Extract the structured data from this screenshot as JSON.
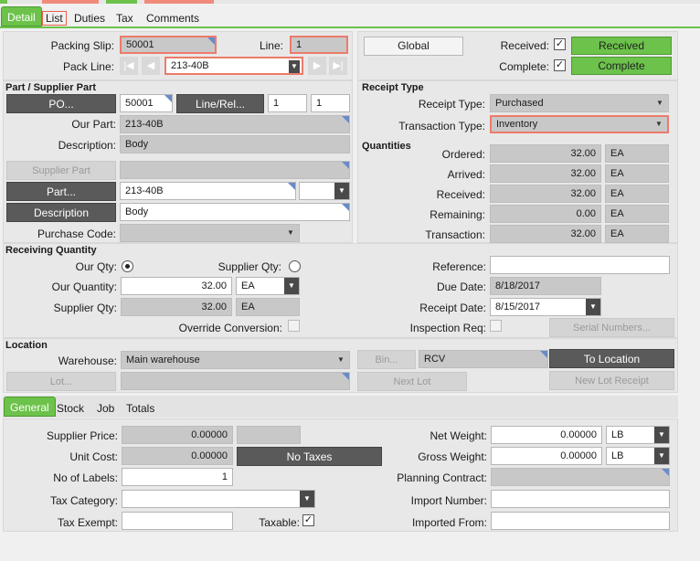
{
  "tabs": {
    "detail": "Detail",
    "list": "List",
    "duties": "Duties",
    "tax": "Tax",
    "comments": "Comments"
  },
  "header": {
    "packing_slip_label": "Packing Slip:",
    "packing_slip_value": "50001",
    "line_label": "Line:",
    "line_value": "1",
    "pack_line_label": "Pack Line:",
    "pack_line_value": "213-40B",
    "global_label": "Global",
    "received_label": "Received:",
    "received_button": "Received",
    "complete_label": "Complete:",
    "complete_button": "Complete",
    "check_glyph": "✓"
  },
  "part_supplier": {
    "title": "Part / Supplier Part",
    "po_button": "PO...",
    "po_value": "50001",
    "line_rel_button": "Line/Rel...",
    "line_value": "1",
    "rel_value": "1",
    "our_part_label": "Our Part:",
    "our_part_value": "213-40B",
    "description_label": "Description:",
    "description_value": "Body",
    "supplier_part_button": "Supplier Part",
    "supplier_part_value": "",
    "part_button": "Part...",
    "part_value": "213-40B",
    "description_button": "Description",
    "description_input": "Body",
    "purchase_code_label": "Purchase Code:",
    "purchase_code_value": ""
  },
  "receipt_type": {
    "title": "Receipt Type",
    "receipt_type_label": "Receipt Type:",
    "receipt_type_value": "Purchased",
    "transaction_type_label": "Transaction Type:",
    "transaction_type_value": "Inventory"
  },
  "quantities": {
    "title": "Quantities",
    "rows": [
      {
        "label": "Ordered:",
        "value": "32.00",
        "uom": "EA"
      },
      {
        "label": "Arrived:",
        "value": "32.00",
        "uom": "EA"
      },
      {
        "label": "Received:",
        "value": "32.00",
        "uom": "EA"
      },
      {
        "label": "Remaining:",
        "value": "0.00",
        "uom": "EA"
      },
      {
        "label": "Transaction:",
        "value": "32.00",
        "uom": "EA"
      }
    ]
  },
  "receiving_qty": {
    "title": "Receiving Quantity",
    "our_qty_label": "Our Qty:",
    "supplier_qty_radio_label": "Supplier Qty:",
    "our_quantity_label": "Our Quantity:",
    "our_quantity_value": "32.00",
    "our_quantity_uom": "EA",
    "supplier_qty_label": "Supplier Qty:",
    "supplier_qty_value": "32.00",
    "supplier_qty_uom": "EA",
    "override_label": "Override Conversion:",
    "reference_label": "Reference:",
    "reference_value": "",
    "due_date_label": "Due Date:",
    "due_date_value": "8/18/2017",
    "receipt_date_label": "Receipt Date:",
    "receipt_date_value": "8/15/2017",
    "inspection_label": "Inspection Req:",
    "serial_button": "Serial Numbers..."
  },
  "location": {
    "title": "Location",
    "warehouse_label": "Warehouse:",
    "warehouse_value": "Main warehouse",
    "bin_button": "Bin...",
    "bin_value": "RCV",
    "to_location_button": "To Location",
    "lot_button": "Lot...",
    "lot_value": "",
    "next_lot_button": "Next Lot",
    "new_lot_receipt_button": "New Lot Receipt"
  },
  "bottom_tabs": {
    "general": "General",
    "stock": "Stock",
    "job": "Job",
    "totals": "Totals"
  },
  "general": {
    "supplier_price_label": "Supplier Price:",
    "supplier_price_value": "0.00000",
    "unit_cost_label": "Unit Cost:",
    "unit_cost_value": "0.00000",
    "no_taxes_button": "No Taxes",
    "no_labels_label": "No of Labels:",
    "no_labels_value": "1",
    "tax_category_label": "Tax Category:",
    "tax_category_value": "",
    "tax_exempt_label": "Tax Exempt:",
    "tax_exempt_value": "",
    "taxable_label": "Taxable:",
    "net_weight_label": "Net Weight:",
    "net_weight_value": "0.00000",
    "net_weight_uom": "LB",
    "gross_weight_label": "Gross Weight:",
    "gross_weight_value": "0.00000",
    "gross_weight_uom": "LB",
    "planning_contract_label": "Planning Contract:",
    "planning_contract_value": "",
    "import_number_label": "Import Number:",
    "import_number_value": "",
    "imported_from_label": "Imported From:",
    "imported_from_value": ""
  },
  "icons": {
    "dropdown": "▼",
    "nav_first": "|◀",
    "nav_prev": "◀",
    "nav_next": "▶",
    "nav_last": "▶|"
  },
  "colors": {
    "accent_green": "#6cc24a",
    "required_border": "#ec7b6a",
    "dark_button": "#5a5a5a"
  }
}
